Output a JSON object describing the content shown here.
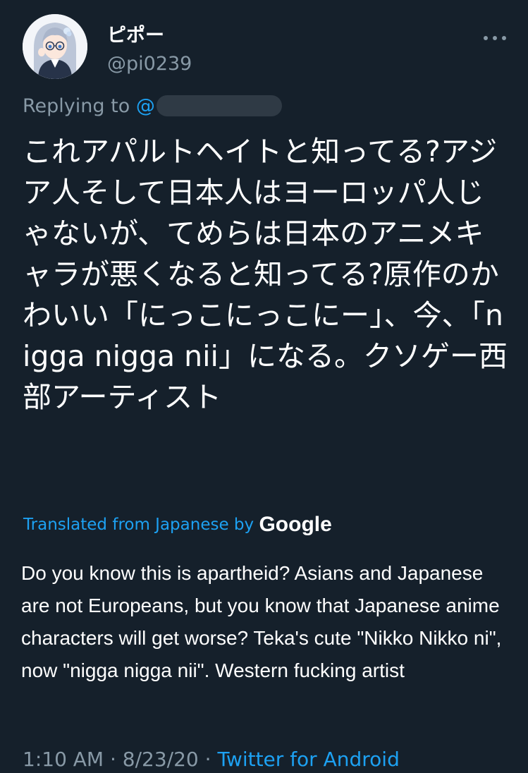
{
  "author": {
    "display_name": "ピポー",
    "handle": "@pi0239"
  },
  "reply": {
    "prefix": "Replying to",
    "at": "@"
  },
  "tweet": {
    "text_jp": "これアパルトヘイトと知ってる?アジア人そして日本人はヨーロッパ人じゃないが、てめらは日本のアニメキャラが悪くなると知ってる?原作のかわいい「にっこにっこにー」、今、「nigga nigga nii」になる。クソゲー西部アーティスト",
    "translated_label": "Translated from Japanese by",
    "translator_brand": "Google",
    "text_en": "Do you know this is apartheid? Asians and Japanese are not Europeans, but you know that Japanese anime characters will get worse? Teka's cute \"Nikko Nikko ni\", now \"nigga nigga nii\". Western fucking artist"
  },
  "meta": {
    "time": "1:10 AM",
    "sep1": " · ",
    "date": "8/23/20",
    "sep2": " · ",
    "source": "Twitter for Android"
  },
  "colors": {
    "background": "#15202b",
    "text": "#ffffff",
    "secondary": "#8899a6",
    "link": "#1da1f2"
  },
  "icons": {
    "more": "more-horizontal-icon"
  }
}
